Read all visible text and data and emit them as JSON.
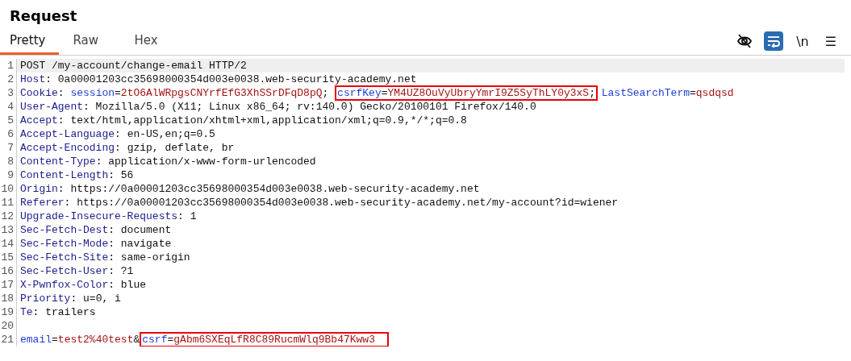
{
  "title": "Request",
  "tabs": [
    {
      "label": "Pretty",
      "selected": true
    },
    {
      "label": "Raw",
      "selected": false
    },
    {
      "label": "Hex",
      "selected": false
    }
  ],
  "toolbar": {
    "wrap_on": true,
    "newline_label": "\\n",
    "menu_label": "☰"
  },
  "lines": [
    {
      "number": "1",
      "current": true,
      "tokens": [
        {
          "kind": "plain",
          "text": "POST /my-account/change-email HTTP/2"
        }
      ]
    },
    {
      "number": "2",
      "current": false,
      "tokens": [
        {
          "kind": "key",
          "text": "Host"
        },
        {
          "kind": "plain",
          "text": ": 0a00001203cc35698000354d003e0038.web-security-academy.net"
        }
      ]
    },
    {
      "number": "3",
      "current": false,
      "tokens": [
        {
          "kind": "key",
          "text": "Cookie"
        },
        {
          "kind": "plain",
          "text": ": "
        },
        {
          "kind": "param",
          "text": "session"
        },
        {
          "kind": "plain",
          "text": "="
        },
        {
          "kind": "value",
          "text": "2tO6AlWRpgsCNYrfEfG3XhSSrDFqD8pQ"
        },
        {
          "kind": "plain",
          "text": "; "
        },
        {
          "kind": "param",
          "text": "csrfKey",
          "boxed": true
        },
        {
          "kind": "plain",
          "text": "=",
          "boxed": true
        },
        {
          "kind": "value",
          "text": "YM4UZ8OuVyUbryYmrI9Z5SyThLY0y3xS",
          "boxed": true
        },
        {
          "kind": "plain",
          "text": ";",
          "boxed": true
        },
        {
          "kind": "param",
          "text": "LastSearchTerm"
        },
        {
          "kind": "plain",
          "text": "="
        },
        {
          "kind": "value",
          "text": "qsdqsd"
        }
      ]
    },
    {
      "number": "4",
      "current": false,
      "tokens": [
        {
          "kind": "key",
          "text": "User-Agent"
        },
        {
          "kind": "plain",
          "text": ": Mozilla/5.0 (X11; Linux x86_64; rv:140.0) Gecko/20100101 Firefox/140.0"
        }
      ]
    },
    {
      "number": "5",
      "current": false,
      "tokens": [
        {
          "kind": "key",
          "text": "Accept"
        },
        {
          "kind": "plain",
          "text": ": text/html,application/xhtml+xml,application/xml;q=0.9,*/*;q=0.8"
        }
      ]
    },
    {
      "number": "6",
      "current": false,
      "tokens": [
        {
          "kind": "key",
          "text": "Accept-Language"
        },
        {
          "kind": "plain",
          "text": ": en-US,en;q=0.5"
        }
      ]
    },
    {
      "number": "7",
      "current": false,
      "tokens": [
        {
          "kind": "key",
          "text": "Accept-Encoding"
        },
        {
          "kind": "plain",
          "text": ": gzip, deflate, br"
        }
      ]
    },
    {
      "number": "8",
      "current": false,
      "tokens": [
        {
          "kind": "key",
          "text": "Content-Type"
        },
        {
          "kind": "plain",
          "text": ": application/x-www-form-urlencoded"
        }
      ]
    },
    {
      "number": "9",
      "current": false,
      "tokens": [
        {
          "kind": "key",
          "text": "Content-Length"
        },
        {
          "kind": "plain",
          "text": ": 56"
        }
      ]
    },
    {
      "number": "10",
      "current": false,
      "tokens": [
        {
          "kind": "key",
          "text": "Origin"
        },
        {
          "kind": "plain",
          "text": ": https://0a00001203cc35698000354d003e0038.web-security-academy.net"
        }
      ]
    },
    {
      "number": "11",
      "current": false,
      "tokens": [
        {
          "kind": "key",
          "text": "Referer"
        },
        {
          "kind": "plain",
          "text": ": https://0a00001203cc35698000354d003e0038.web-security-academy.net/my-account?id=wiener"
        }
      ]
    },
    {
      "number": "12",
      "current": false,
      "tokens": [
        {
          "kind": "key",
          "text": "Upgrade-Insecure-Requests"
        },
        {
          "kind": "plain",
          "text": ": 1"
        }
      ]
    },
    {
      "number": "13",
      "current": false,
      "tokens": [
        {
          "kind": "key",
          "text": "Sec-Fetch-Dest"
        },
        {
          "kind": "plain",
          "text": ": document"
        }
      ]
    },
    {
      "number": "14",
      "current": false,
      "tokens": [
        {
          "kind": "key",
          "text": "Sec-Fetch-Mode"
        },
        {
          "kind": "plain",
          "text": ": navigate"
        }
      ]
    },
    {
      "number": "15",
      "current": false,
      "tokens": [
        {
          "kind": "key",
          "text": "Sec-Fetch-Site"
        },
        {
          "kind": "plain",
          "text": ": same-origin"
        }
      ]
    },
    {
      "number": "16",
      "current": false,
      "tokens": [
        {
          "kind": "key",
          "text": "Sec-Fetch-User"
        },
        {
          "kind": "plain",
          "text": ": ?1"
        }
      ]
    },
    {
      "number": "17",
      "current": false,
      "tokens": [
        {
          "kind": "key",
          "text": "X-Pwnfox-Color"
        },
        {
          "kind": "plain",
          "text": ": blue"
        }
      ]
    },
    {
      "number": "18",
      "current": false,
      "tokens": [
        {
          "kind": "key",
          "text": "Priority"
        },
        {
          "kind": "plain",
          "text": ": u=0, i"
        }
      ]
    },
    {
      "number": "19",
      "current": false,
      "tokens": [
        {
          "kind": "key",
          "text": "Te"
        },
        {
          "kind": "plain",
          "text": ": trailers"
        }
      ]
    },
    {
      "number": "20",
      "current": false
    },
    {
      "number": "21",
      "current": false,
      "tokens": [
        {
          "kind": "param",
          "text": "email"
        },
        {
          "kind": "plain",
          "text": "="
        },
        {
          "kind": "value",
          "text": "test2%40test"
        },
        {
          "kind": "plain",
          "text": "&"
        },
        {
          "kind": "param",
          "text": "csrf",
          "boxed": true
        },
        {
          "kind": "plain",
          "text": "=",
          "boxed": true
        },
        {
          "kind": "value",
          "text": "gAbm6SXEqLfR8C89RucmWlq9Bb47Kww3",
          "boxed": true
        }
      ]
    }
  ]
}
